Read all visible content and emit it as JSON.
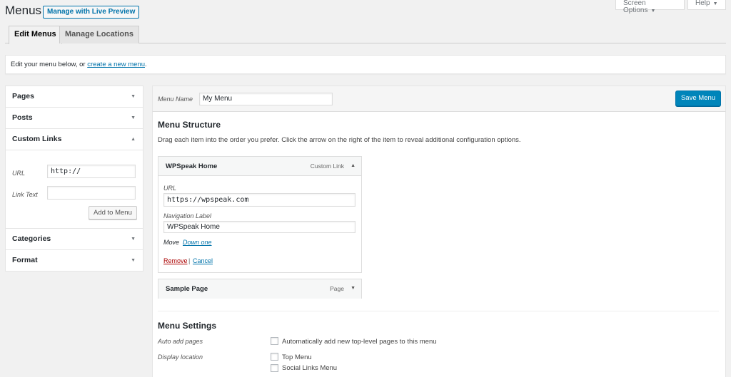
{
  "header": {
    "title": "Menus",
    "preview_label": "Manage with Live Preview",
    "screen_options_label": "Screen Options",
    "help_label": "Help"
  },
  "tabs": [
    {
      "label": "Edit Menus",
      "active": true
    },
    {
      "label": "Manage Locations",
      "active": false
    }
  ],
  "notice": {
    "text_before": "Edit your menu below, or ",
    "link_text": "create a new menu",
    "text_after": "."
  },
  "sidebar": {
    "sections": [
      {
        "label": "Pages"
      },
      {
        "label": "Posts"
      },
      {
        "label": "Custom Links"
      },
      {
        "label": "Categories"
      },
      {
        "label": "Format"
      }
    ],
    "custom_links": {
      "url_label": "URL",
      "url_value": "http://",
      "link_text_label": "Link Text",
      "link_text_value": "",
      "add_button": "Add to Menu"
    }
  },
  "menu": {
    "name_label": "Menu Name",
    "name_value": "My Menu",
    "save_label": "Save Menu",
    "structure_title": "Menu Structure",
    "structure_desc": "Drag each item into the order you prefer. Click the arrow on the right of the item to reveal additional configuration options.",
    "items": [
      {
        "title": "WPSpeak Home",
        "type": "Custom Link",
        "url_label": "URL",
        "url_value": "https://wpspeak.com",
        "nav_label_label": "Navigation Label",
        "nav_label_value": "WPSpeak Home",
        "move_label": "Move",
        "move_link": "Down one",
        "remove_label": "Remove",
        "separator": "|",
        "cancel_label": "Cancel"
      },
      {
        "title": "Sample Page",
        "type": "Page"
      }
    ],
    "settings": {
      "title": "Menu Settings",
      "auto_add_label": "Auto add pages",
      "auto_add_option": "Automatically add new top-level pages to this menu",
      "display_location_label": "Display location",
      "locations": [
        "Top Menu",
        "Social Links Menu"
      ]
    }
  },
  "colors": {
    "accent": "#0073aa",
    "primary_button": "#0085ba",
    "danger": "#aa0000"
  }
}
